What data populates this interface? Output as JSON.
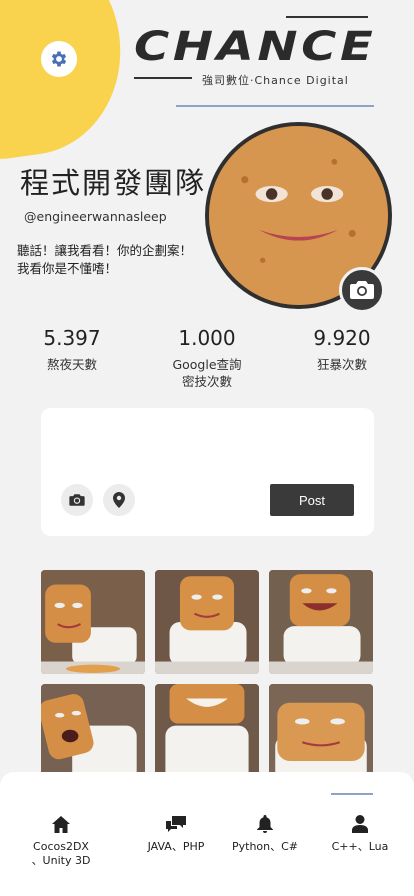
{
  "header": {
    "logo_text": "CHANCE",
    "logo_sub": "強司數位·Chance Digital"
  },
  "profile": {
    "name": "程式開發團隊",
    "handle": "@engineerwannasleep",
    "bio": "聽話！讓我看看！你的企劃案！\n我看你是不懂嗜！"
  },
  "stats": [
    {
      "value": "5.397",
      "label": "熬夜天數"
    },
    {
      "value": "1.000",
      "label": "Google查詢\n密技次數"
    },
    {
      "value": "9.920",
      "label": "狂暴次數"
    }
  ],
  "composer": {
    "post_label": "Post"
  },
  "nav": [
    {
      "icon": "home-icon",
      "label": "Cocos2DX\n、Unity 3D"
    },
    {
      "icon": "chat-icon",
      "label": "JAVA、PHP"
    },
    {
      "icon": "bell-icon",
      "label": "Python、C#"
    },
    {
      "icon": "user-icon",
      "label": "C++、Lua"
    }
  ],
  "colors": {
    "accent_yellow": "#f9d34d",
    "rule_blue": "#8fa2c6",
    "dark": "#3a3a3a"
  }
}
